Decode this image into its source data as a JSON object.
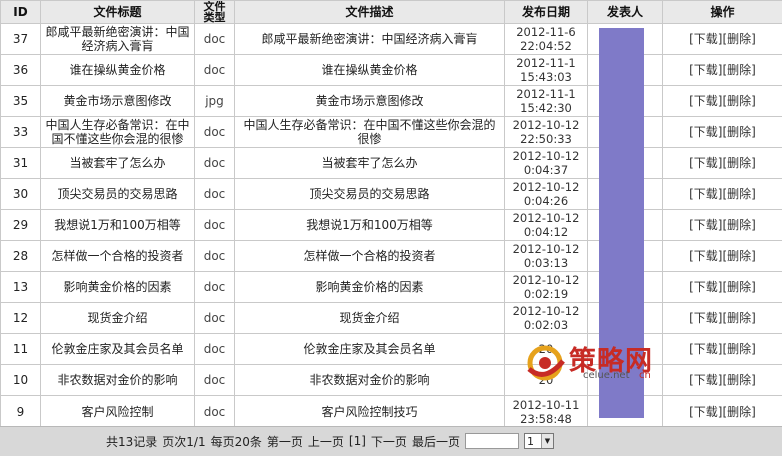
{
  "headers": {
    "id": "ID",
    "title": "文件标题",
    "type_line1": "文件",
    "type_line2": "类型",
    "desc": "文件描述",
    "date": "发布日期",
    "author": "发表人",
    "ops": "操作"
  },
  "rows": [
    {
      "id": "37",
      "title": "郎咸平最新绝密演讲：中国经济病入膏肓",
      "type": "doc",
      "desc": "郎咸平最新绝密演讲：中国经济病入膏肓",
      "date": "2012-11-6",
      "time": "22:04:52"
    },
    {
      "id": "36",
      "title": "谁在操纵黄金价格",
      "type": "doc",
      "desc": "谁在操纵黄金价格",
      "date": "2012-11-1",
      "time": "15:43:03"
    },
    {
      "id": "35",
      "title": "黄金市场示意图修改",
      "type": "jpg",
      "desc": "黄金市场示意图修改",
      "date": "2012-11-1",
      "time": "15:42:30"
    },
    {
      "id": "33",
      "title": "中国人生存必备常识：在中国不懂这些你会混的很惨",
      "type": "doc",
      "desc": "中国人生存必备常识：在中国不懂这些你会混的很惨",
      "date": "2012-10-12",
      "time": "22:50:33"
    },
    {
      "id": "31",
      "title": "当被套牢了怎么办",
      "type": "doc",
      "desc": "当被套牢了怎么办",
      "date": "2012-10-12",
      "time": "0:04:37"
    },
    {
      "id": "30",
      "title": "顶尖交易员的交易思路",
      "type": "doc",
      "desc": "顶尖交易员的交易思路",
      "date": "2012-10-12",
      "time": "0:04:26"
    },
    {
      "id": "29",
      "title": "我想说1万和100万相等",
      "type": "doc",
      "desc": "我想说1万和100万相等",
      "date": "2012-10-12",
      "time": "0:04:12"
    },
    {
      "id": "28",
      "title": "怎样做一个合格的投资者",
      "type": "doc",
      "desc": "怎样做一个合格的投资者",
      "date": "2012-10-12",
      "time": "0:03:13"
    },
    {
      "id": "13",
      "title": "影响黄金价格的因素",
      "type": "doc",
      "desc": "影响黄金价格的因素",
      "date": "2012-10-12",
      "time": "0:02:19"
    },
    {
      "id": "12",
      "title": "现货金介绍",
      "type": "doc",
      "desc": "现货金介绍",
      "date": "2012-10-12",
      "time": "0:02:03"
    },
    {
      "id": "11",
      "title": "伦敦金庄家及其会员名单",
      "type": "doc",
      "desc": "伦敦金庄家及其会员名单",
      "date": "20",
      "time": ""
    },
    {
      "id": "10",
      "title": "非农数据对金价的影响",
      "type": "doc",
      "desc": "非农数据对金价的影响",
      "date": "20",
      "time": ""
    },
    {
      "id": "9",
      "title": "客户风险控制",
      "type": "doc",
      "desc": "客户风险控制技巧",
      "date": "2012-10-11",
      "time": "23:58:48"
    }
  ],
  "ops": {
    "download": "[下载]",
    "delete": "[删除]"
  },
  "pager": {
    "total": "共13记录",
    "pages": "页次1/1",
    "per_page": "每页20条",
    "first": "第一页",
    "prev": "上一页",
    "current": "[1]",
    "next": "下一页",
    "last": "最后一页",
    "jump_value": "",
    "select_value": "1"
  },
  "watermark": {
    "brand": "策略网",
    "domain": "celue.net",
    "suffix": "cn"
  },
  "colors": {
    "author_redaction": "#7f7ac8",
    "header_bg": "#e9e9e9",
    "footer_bg": "#d8d8d8",
    "brand_red": "#c72b25"
  }
}
